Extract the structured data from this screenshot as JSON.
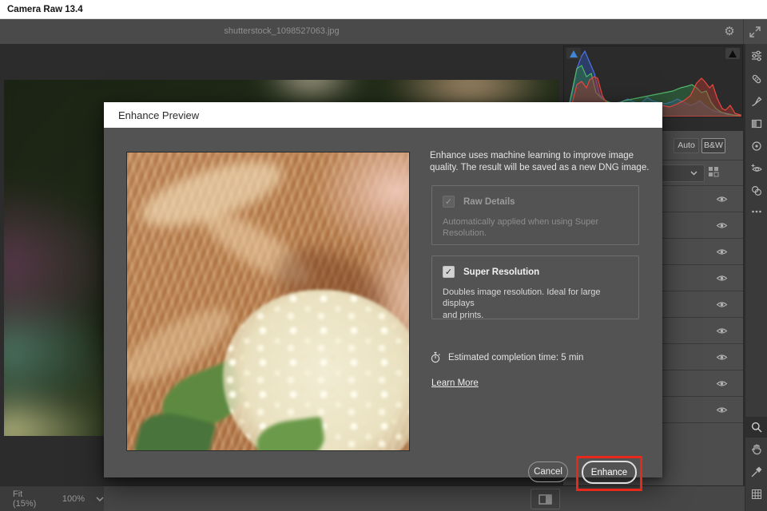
{
  "window": {
    "title": "Camera Raw 13.4"
  },
  "app_bar": {
    "filename": "shutterstock_1098527063.jpg",
    "icons": [
      "gear-icon",
      "toggle-fullscreen-icon"
    ]
  },
  "histogram": {
    "description": "RGB histogram",
    "indicators": [
      "shadow-clipping-triangle",
      "highlight-clipping-triangle"
    ],
    "colors": {
      "red": "#e8483f",
      "green": "#53b86a",
      "blue": "#4f74e3",
      "background": "#2b2b2b"
    }
  },
  "right_panel": {
    "auto_label": "Auto",
    "bw_label": "B&W",
    "eye_rows": 9,
    "icons": [
      "chevron-down-icon",
      "profile-browser-icon",
      "eye-icon"
    ]
  },
  "toolbar": {
    "icons": [
      "edit-sliders-icon",
      "healing-icon",
      "brush-icon",
      "masking-icon",
      "radial-icon",
      "red-eye-icon",
      "presets-icon",
      "more-dots-icon",
      "zoom-tool-icon",
      "hand-tool-icon",
      "sampler-icon",
      "grid-overlay-icon"
    ],
    "selected_tool": "zoom-tool-icon"
  },
  "bottom_bar": {
    "fit_label": "Fit (15%)",
    "zoom_level": "100%",
    "icons": [
      "chevron-down-icon",
      "before-after-view-icon"
    ]
  },
  "dialog": {
    "title": "Enhance Preview",
    "description": "Enhance uses machine learning to improve image\nquality. The result will be saved as a new DNG image.",
    "raw_details": {
      "label": "Raw Details",
      "checked": true,
      "disabled": true,
      "check_glyph": "✓",
      "description": "Automatically applied when using Super\nResolution."
    },
    "super_resolution": {
      "label": "Super Resolution",
      "checked": true,
      "check_glyph": "✓",
      "description": "Doubles image resolution. Ideal for large displays\nand prints."
    },
    "estimated_time": "Estimated completion time: 5 min",
    "learn_more_label": "Learn More",
    "cancel_label": "Cancel",
    "enhance_label": "Enhance"
  },
  "annotation": {
    "highlight_color": "#e8281a",
    "highlighted_control": "enhance-button"
  },
  "colors": {
    "app_bar": "#4a4a4a",
    "canvas": "#2c2c2c",
    "dialog_body": "#535353",
    "panel_row": "#4d4d4d",
    "toolbar": "#3a3a3a"
  }
}
